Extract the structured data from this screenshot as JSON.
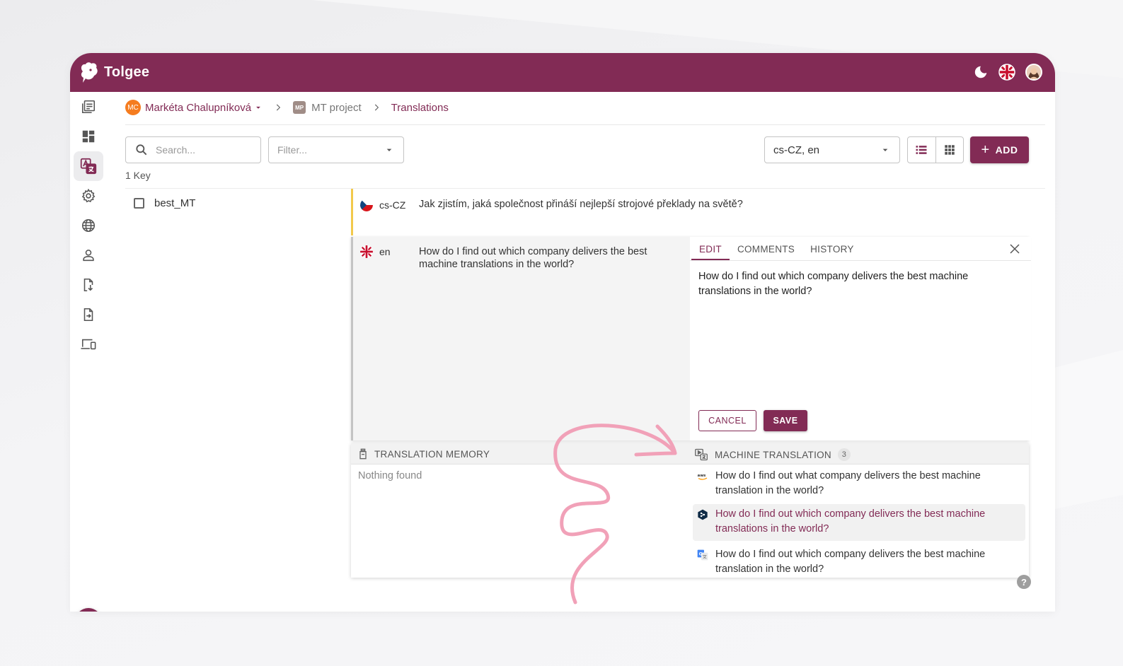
{
  "app": {
    "name": "Tolgee"
  },
  "breadcrumb": {
    "org_initials": "MC",
    "org_name": "Markéta Chalupníková",
    "project_initials": "MP",
    "project_name": "MT project",
    "current": "Translations"
  },
  "toolbar": {
    "search_placeholder": "Search...",
    "filter_placeholder": "Filter...",
    "languages_value": "cs-CZ, en",
    "add_label": "ADD"
  },
  "key_count": "1 Key",
  "key": {
    "name": "best_MT"
  },
  "translations": {
    "cs": {
      "lang": "cs-CZ",
      "text": "Jak zjistím, jaká společnost přináší nejlepší strojové překlady na světě?"
    },
    "en": {
      "lang": "en",
      "text": "How do I find out which company delivers the best machine translations in the world?"
    }
  },
  "editor": {
    "tabs": [
      "EDIT",
      "COMMENTS",
      "HISTORY"
    ],
    "value": "How do I find out which company delivers the best machine translations in the world?",
    "cancel_label": "CANCEL",
    "save_label": "SAVE"
  },
  "tools": {
    "tm_title": "TRANSLATION MEMORY",
    "tm_empty": "Nothing found",
    "mt_title": "MACHINE TRANSLATION",
    "mt_count": "3",
    "mt_items": [
      {
        "provider": "aws-icon",
        "text": "How do I find out what company delivers the best machine translation in the world?"
      },
      {
        "provider": "deepl-icon",
        "text": "How do I find out which company delivers the best machine translations in the world?"
      },
      {
        "provider": "google-translate-icon",
        "text": "How do I find out which company delivers the best machine translation in the world?"
      }
    ]
  },
  "colors": {
    "brand": "#822b55",
    "accent_yellow": "#f2c94c",
    "org_badge": "#f57c1f"
  }
}
